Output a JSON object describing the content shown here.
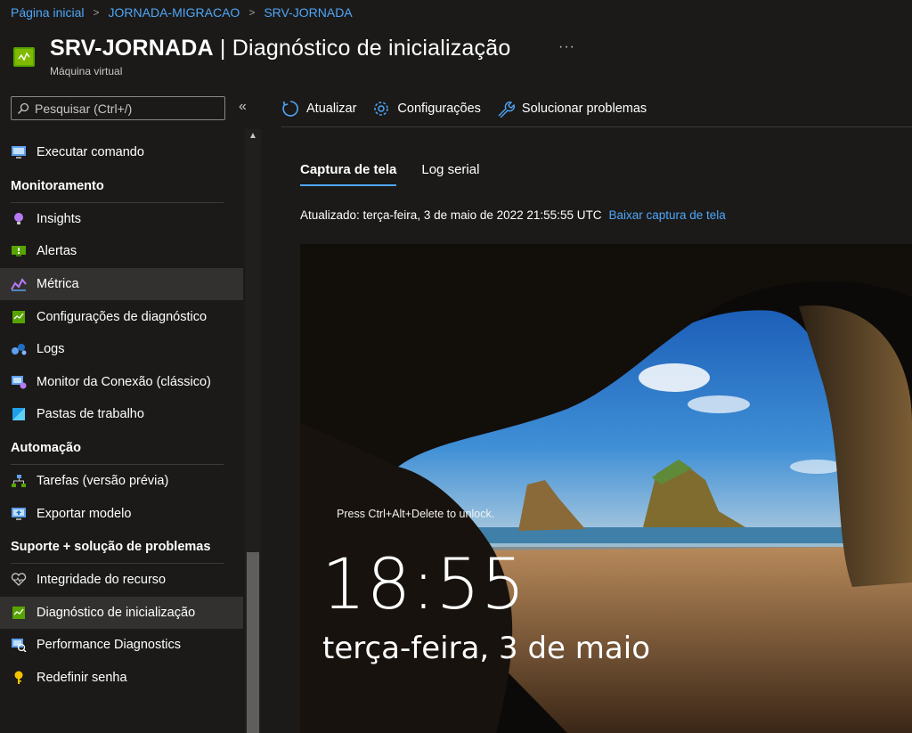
{
  "breadcrumb": [
    "Página inicial",
    "JORNADA-MIGRACAO",
    "SRV-JORNADA"
  ],
  "header": {
    "title_resource": "SRV-JORNADA",
    "title_separator": " | ",
    "title_page": "Diagnóstico de inicialização",
    "subtitle": "Máquina virtual",
    "more": "···"
  },
  "search": {
    "placeholder": "Pesquisar (Ctrl+/)",
    "collapse": "«"
  },
  "menu": {
    "top_item": "Executar comando",
    "monitoring_header": "Monitoramento",
    "monitoring": [
      "Insights",
      "Alertas",
      "Métrica",
      "Configurações de diagnóstico",
      "Logs",
      "Monitor da Conexão (clássico)",
      "Pastas de trabalho"
    ],
    "automation_header": "Automação",
    "automation": [
      "Tarefas (versão prévia)",
      "Exportar modelo"
    ],
    "support_header": "Suporte + solução de problemas",
    "support": [
      "Integridade do recurso",
      "Diagnóstico de inicialização",
      "Performance Diagnostics",
      "Redefinir senha"
    ]
  },
  "toolbar": {
    "refresh": "Atualizar",
    "settings": "Configurações",
    "troubleshoot": "Solucionar problemas"
  },
  "tabs": [
    "Captura de tela",
    "Log serial"
  ],
  "status": {
    "updated": "Atualizado: terça-feira, 3 de maio de 2022 21:55:55 UTC",
    "download": "Baixar captura de tela"
  },
  "lockscreen": {
    "hint": "Press Ctrl+Alt+Delete to unlock.",
    "time": "18:55",
    "date": "terça-feira, 3 de maio"
  },
  "colors": {
    "accent": "#4fa6f7",
    "background": "#1b1a19",
    "active_item": "#323130"
  }
}
